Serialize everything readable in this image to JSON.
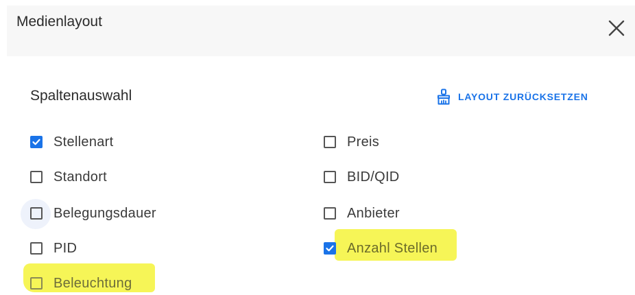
{
  "dialog": {
    "title": "Medienlayout",
    "close_icon": "close-icon"
  },
  "section": {
    "title": "Spaltenauswahl",
    "reset_label": "LAYOUT ZURÜCKSETZEN",
    "reset_icon": "brush-icon"
  },
  "columns": {
    "left": [
      {
        "label": "Stellenart",
        "checked": true
      },
      {
        "label": "Standort",
        "checked": false
      },
      {
        "label": "Belegungsdauer",
        "checked": false
      },
      {
        "label": "PID",
        "checked": false
      },
      {
        "label": "Beleuchtung",
        "checked": false
      }
    ],
    "right": [
      {
        "label": "Preis",
        "checked": false
      },
      {
        "label": "BID/QID",
        "checked": false
      },
      {
        "label": "Anbieter",
        "checked": false
      },
      {
        "label": "Anzahl Stellen",
        "checked": true
      }
    ]
  },
  "colors": {
    "accent": "#1a73e8",
    "highlight": "#f5f33a"
  }
}
